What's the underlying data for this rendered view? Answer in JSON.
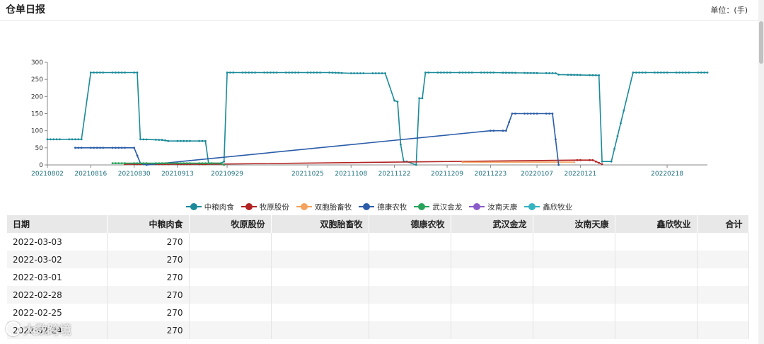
{
  "header": {
    "title": "仓单日报",
    "unit": "单位：(手)"
  },
  "colors": {
    "series": [
      "#1a8a99",
      "#b22222",
      "#f5a25d",
      "#2a5ca8",
      "#27a25a",
      "#8a5cc9",
      "#36b3c1"
    ],
    "axis": "#888888",
    "tick_text": "#1a6f7f"
  },
  "chart_data": {
    "type": "line",
    "x_ticks": [
      "20210802",
      "20210816",
      "20210830",
      "20210913",
      "20210929",
      "20211025",
      "20211108",
      "20211122",
      "20211209",
      "20211223",
      "20220107",
      "20220121",
      "20220218"
    ],
    "y_ticks": [
      "0",
      "50",
      "100",
      "150",
      "200",
      "250",
      "300"
    ],
    "ylim": [
      0,
      300
    ],
    "xlim": [
      "2021-08-02",
      "2022-03-03"
    ],
    "legend_position": "bottom-center",
    "series": [
      {
        "name": "中粮肉食",
        "points": [
          [
            "2021-08-02",
            75
          ],
          [
            "2021-08-13",
            75
          ],
          [
            "2021-08-16",
            270
          ],
          [
            "2021-08-31",
            270
          ],
          [
            "2021-09-01",
            75
          ],
          [
            "2021-09-08",
            73
          ],
          [
            "2021-09-10",
            70
          ],
          [
            "2021-09-14",
            70
          ],
          [
            "2021-09-22",
            70
          ],
          [
            "2021-09-23",
            5
          ],
          [
            "2021-09-27",
            5
          ],
          [
            "2021-09-28",
            10
          ],
          [
            "2021-09-29",
            270
          ],
          [
            "2021-10-08",
            270
          ],
          [
            "2021-11-01",
            270
          ],
          [
            "2021-11-08",
            268
          ],
          [
            "2021-11-19",
            268
          ],
          [
            "2021-11-22",
            188
          ],
          [
            "2021-11-23",
            185
          ],
          [
            "2021-11-24",
            60
          ],
          [
            "2021-11-25",
            10
          ],
          [
            "2021-11-26",
            10
          ],
          [
            "2021-11-29",
            0
          ],
          [
            "2021-11-30",
            195
          ],
          [
            "2021-12-01",
            195
          ],
          [
            "2021-12-02",
            270
          ],
          [
            "2021-12-23",
            270
          ],
          [
            "2022-01-13",
            268
          ],
          [
            "2022-01-14",
            264
          ],
          [
            "2022-01-27",
            262
          ],
          [
            "2022-01-28",
            10
          ],
          [
            "2022-01-31",
            10
          ],
          [
            "2022-02-07",
            270
          ],
          [
            "2022-03-03",
            270
          ]
        ]
      },
      {
        "name": "牧原股份",
        "points": [
          [
            "2021-08-27",
            2
          ],
          [
            "2021-09-22",
            2
          ],
          [
            "2022-01-20",
            14
          ],
          [
            "2022-01-25",
            14
          ],
          [
            "2022-01-28",
            2
          ]
        ]
      },
      {
        "name": "双胞胎畜牧",
        "points": [
          [
            "2021-12-14",
            8
          ],
          [
            "2022-01-19",
            8
          ]
        ]
      },
      {
        "name": "德康农牧",
        "points": [
          [
            "2021-08-11",
            50
          ],
          [
            "2021-08-27",
            50
          ],
          [
            "2021-08-30",
            50
          ],
          [
            "2021-09-01",
            5
          ],
          [
            "2021-09-03",
            0
          ],
          [
            "2021-12-23",
            100
          ],
          [
            "2021-12-28",
            100
          ],
          [
            "2021-12-30",
            150
          ],
          [
            "2022-01-12",
            150
          ],
          [
            "2022-01-14",
            0
          ]
        ]
      },
      {
        "name": "武汉金龙",
        "points": [
          [
            "2021-08-23",
            5
          ],
          [
            "2021-09-01",
            5
          ],
          [
            "2021-09-27",
            5
          ],
          [
            "2021-09-28",
            0
          ]
        ]
      },
      {
        "name": "汝南天康",
        "points": []
      },
      {
        "name": "鑫欣牧业",
        "points": []
      }
    ]
  },
  "table": {
    "columns": [
      "日期",
      "中粮肉食",
      "牧原股份",
      "双胞胎畜牧",
      "德康农牧",
      "武汉金龙",
      "汝南天康",
      "鑫欣牧业",
      "合计"
    ],
    "rows": [
      [
        "2022-03-03",
        "270",
        "",
        "",
        "",
        "",
        "",
        "",
        ""
      ],
      [
        "2022-03-02",
        "270",
        "",
        "",
        "",
        "",
        "",
        "",
        ""
      ],
      [
        "2022-03-01",
        "270",
        "",
        "",
        "",
        "",
        "",
        "",
        ""
      ],
      [
        "2022-02-28",
        "270",
        "",
        "",
        "",
        "",
        "",
        "",
        ""
      ],
      [
        "2022-02-25",
        "270",
        "",
        "",
        "",
        "",
        "",
        "",
        ""
      ],
      [
        "2022-02-24",
        "270",
        "",
        "",
        "",
        "",
        "",
        "",
        ""
      ]
    ]
  },
  "watermark": {
    "text": "大数跨境"
  }
}
